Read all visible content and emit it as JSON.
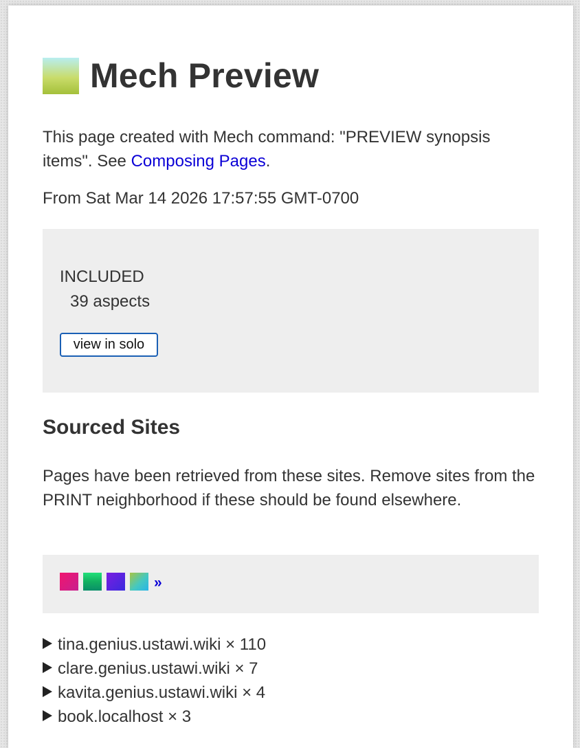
{
  "title": "Mech Preview",
  "intro": {
    "text": "This page created with Mech command: \"PREVIEW synopsis items\". See ",
    "link": "Composing Pages",
    "suffix": "."
  },
  "from_line": "From Sat Mar 14 2026 17:57:55 GMT-0700",
  "included": {
    "label": "INCLUDED",
    "count": "39 aspects",
    "button": "view in solo"
  },
  "sourced": {
    "heading": "Sourced Sites",
    "description": "Pages have been retrieved from these sites. Remove sites from the PRINT neighborhood if these should be found elsewhere.",
    "more_link": "»",
    "sites": [
      {
        "name": "tina.genius.ustawi.wiki",
        "count": " × 110"
      },
      {
        "name": "clare.genius.ustawi.wiki",
        "count": " × 7"
      },
      {
        "name": "kavita.genius.ustawi.wiki",
        "count": " × 4"
      },
      {
        "name": "book.localhost",
        "count": " × 3"
      }
    ]
  },
  "colors": {
    "link": "#0b00d6",
    "panel": "#eeeeee",
    "button_border": "#1a5fb4"
  }
}
